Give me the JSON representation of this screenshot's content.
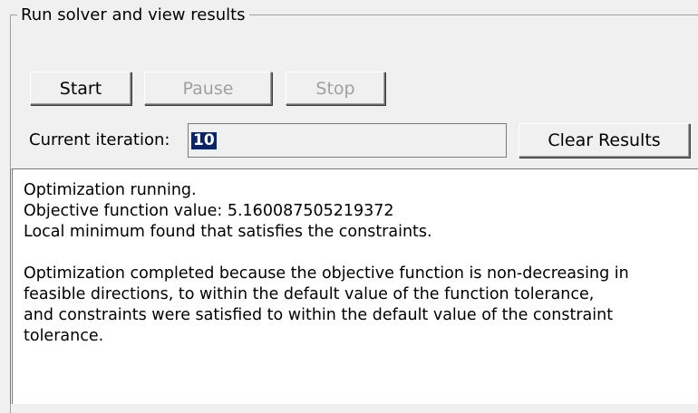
{
  "panel": {
    "title": "Run solver and view results"
  },
  "buttons": {
    "start": "Start",
    "pause": "Pause",
    "stop": "Stop",
    "clear": "Clear Results"
  },
  "iteration": {
    "label": "Current iteration:",
    "value": "10"
  },
  "results": {
    "lines": [
      "Optimization running.",
      "Objective function value: 5.160087505219372",
      "Local minimum found that satisfies the constraints."
    ],
    "paragraph": [
      "Optimization completed because the objective function is non-decreasing in",
      "feasible directions, to within the default value of the function tolerance,",
      "and constraints were satisfied to within the default value of the constraint",
      "tolerance."
    ]
  }
}
